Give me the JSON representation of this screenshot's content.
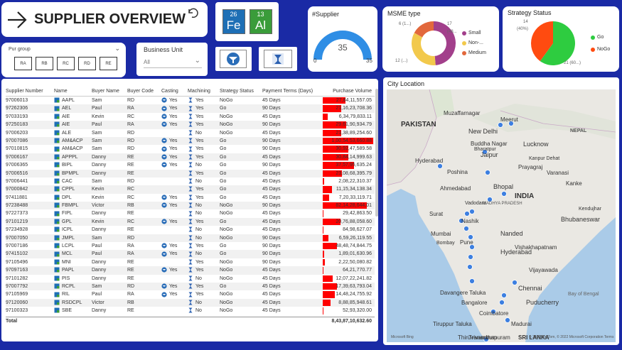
{
  "header": {
    "title": "SUPPLIER OVERVIEW",
    "back_icon": "arrow-right-icon",
    "undo_icon": "undo-icon"
  },
  "elements": [
    {
      "number": "26",
      "symbol": "Fe"
    },
    {
      "number": "13",
      "symbol": "Al"
    }
  ],
  "pur_group": {
    "label": "Pur group",
    "options": [
      "RA",
      "RB",
      "RC",
      "RD",
      "RE"
    ]
  },
  "business_unit": {
    "label": "Business Unit",
    "value": "All"
  },
  "supplier_card": {
    "title": "#Supplier",
    "value": "35",
    "min": "0",
    "max": "35",
    "fraction": 1.0
  },
  "msme": {
    "title": "MSME type",
    "legend": [
      {
        "label": "Small",
        "color": "#a23f8b"
      },
      {
        "label": "Non-...",
        "color": "#f2c94c"
      },
      {
        "label": "Medium",
        "color": "#e2683c"
      }
    ],
    "labels": [
      "17",
      "(48...",
      "6 (1...)",
      "12 (...)"
    ],
    "values": [
      17,
      12,
      6
    ]
  },
  "strategy_status": {
    "title": "Strategy Status",
    "legend": [
      {
        "label": "Go",
        "color": "#2ecc40"
      },
      {
        "label": "NoGo",
        "color": "#ff4b10"
      }
    ],
    "labels": [
      "14",
      "(40%)",
      "21 (60...)"
    ],
    "values": [
      21,
      14
    ]
  },
  "table": {
    "columns": [
      "Supplier Number",
      "Name",
      "Buyer Name",
      "Buyer Code",
      "Casting",
      "Machining",
      "Strategy Status",
      "Payment Terms (Days)",
      "Purchase Volume"
    ],
    "rows": [
      [
        "97006013",
        "AAPL",
        "Sam",
        "RD",
        "Yes",
        "Yes",
        "NoGo",
        "45 Days",
        "27,84,11,557.05",
        0.45
      ],
      [
        "97262306",
        "AEL",
        "Paul",
        "RA",
        "Yes",
        "Yes",
        "Go",
        "90 Days",
        "21,16,23,708.36",
        0.36
      ],
      [
        "97033193",
        "AIE",
        "Kevin",
        "RC",
        "Yes",
        "Yes",
        "NoGo",
        "45 Days",
        "6,34,79,833.11",
        0.1
      ],
      [
        "97250183",
        "AIE",
        "Paul",
        "RA",
        "Yes",
        "Yes",
        "NoGo",
        "90 Days",
        "29,61,90,934.79",
        0.47
      ],
      [
        "97006203",
        "ALE",
        "Sam",
        "RD",
        "",
        "No",
        "NoGo",
        "45 Days",
        "21,38,89,254.60",
        0.36
      ],
      [
        "97007086",
        "AM&ACP",
        "Sam",
        "RD",
        "Yes",
        "Yes",
        "Go",
        "90 Days",
        "1,00,54,53,660.88",
        1.0
      ],
      [
        "97010815",
        "AM&ACP",
        "Sam",
        "RD",
        "Yes",
        "Yes",
        "Go",
        "90 Days",
        "30,92,47,589.58",
        0.5
      ],
      [
        "97006167",
        "APPPL",
        "Danny",
        "RE",
        "Yes",
        "Yes",
        "Go",
        "45 Days",
        "30,84,14,999.63",
        0.5
      ],
      [
        "97006365",
        "BIPL",
        "Danny",
        "RE",
        "Yes",
        "No",
        "Go",
        "90 Days",
        "37,57,95,635.24",
        0.62
      ],
      [
        "97006516",
        "BPMPL",
        "Danny",
        "RE",
        "",
        "Yes",
        "Go",
        "45 Days",
        "23,08,68,395.79",
        0.38
      ],
      [
        "97006441",
        "CAC",
        "Sam",
        "RD",
        "",
        "No",
        "Go",
        "45 Days",
        "2,08,22,310.37",
        0.03
      ],
      [
        "97000842",
        "CPPL",
        "Kevin",
        "RC",
        "",
        "Yes",
        "Go",
        "45 Days",
        "11,15,34,138.34",
        0.18
      ],
      [
        "97411881",
        "DPL",
        "Kevin",
        "RC",
        "Yes",
        "Yes",
        "Go",
        "45 Days",
        "7,20,33,119.71",
        0.12
      ],
      [
        "97238488",
        "FBMPL",
        "Victor",
        "RB",
        "Yes",
        "No",
        "NoGo",
        "90 Days",
        "82,14,28,644.01",
        0.88
      ],
      [
        "97227373",
        "FIPL",
        "Danny",
        "RE",
        "",
        "No",
        "NoGo",
        "45 Days",
        "29,42,863.50",
        0.01
      ],
      [
        "97101219",
        "GPL",
        "Kevin",
        "RC",
        "Yes",
        "Yes",
        "Go",
        "45 Days",
        "20,76,88,058.60",
        0.35
      ],
      [
        "97234928",
        "ICPL",
        "Danny",
        "RE",
        "",
        "No",
        "NoGo",
        "45 Days",
        "84,98,627.07",
        0.02
      ],
      [
        "97007050",
        "JMPL",
        "Sam",
        "RD",
        "",
        "No",
        "NoGo",
        "90 Days",
        "6,59,26,119.55",
        0.11
      ],
      [
        "97007186",
        "LCPL",
        "Paul",
        "RA",
        "Yes",
        "Yes",
        "Go",
        "90 Days",
        "48,48,74,844.75",
        0.28
      ],
      [
        "97415102",
        "MCL",
        "Paul",
        "RA",
        "Yes",
        "No",
        "Go",
        "90 Days",
        "1,89,01,630.96",
        0.03
      ],
      [
        "97105496",
        "MNI",
        "Danny",
        "RE",
        "",
        "Yes",
        "NoGo",
        "90 Days",
        "2,22,50,080.82",
        0.04
      ],
      [
        "97097163",
        "PAPL",
        "Danny",
        "RE",
        "Yes",
        "Yes",
        "NoGo",
        "45 Days",
        "64,21,770.77",
        0.01
      ],
      [
        "97101282",
        "PIS",
        "Danny",
        "RE",
        "",
        "No",
        "NoGo",
        "45 Days",
        "12,07,22,241.82",
        0.2
      ],
      [
        "97007792",
        "RCPL",
        "Sam",
        "RD",
        "Yes",
        "Yes",
        "Go",
        "45 Days",
        "17,39,63,793.04",
        0.28
      ],
      [
        "97105969",
        "RIL",
        "Paul",
        "RA",
        "Yes",
        "Yes",
        "NoGo",
        "45 Days",
        "14,48,24,755.92",
        0.24
      ],
      [
        "97120060",
        "RSDCPL",
        "Victor",
        "RB",
        "",
        "No",
        "NoGo",
        "45 Days",
        "8,88,85,948.61",
        0.15
      ],
      [
        "97100323",
        "SBE",
        "Danny",
        "RE",
        "",
        "No",
        "NoGo",
        "45 Days",
        "52,93,320.00",
        0.01
      ]
    ],
    "total_label": "Total",
    "total_value": "8,43,87,10,632.60"
  },
  "map": {
    "title": "City Location",
    "labels": [
      "PAKISTAN",
      "Muzaffarnagar",
      "Meerut",
      "NEPAL",
      "New Delhi",
      "Buddha Nagar",
      "Lucknow",
      "Jaipur",
      "Bharatpur",
      "Kanpur Dehat",
      "Hyderabad",
      "Poshina",
      "Prayagraj",
      "Varanasi",
      "Ahmedabad",
      "Bhopal",
      "Kanke",
      "Surat",
      "INDIA",
      "Vadodara",
      "MADHYA PRADESH",
      "Kendujhar",
      "Nashik",
      "Bhubaneswar",
      "Mumbai",
      "Bombay",
      "Nanded",
      "Pune",
      "Vishakhapatnam",
      "Hyderabad",
      "Vijayawada",
      "Chennai",
      "Davangere Taluka",
      "Bangalore",
      "Puducherry",
      "Coimbatore",
      "Tiruppur Taluka",
      "Madurai",
      "Trivandrum",
      "Thiruvananthapuram",
      "SRI LANKA",
      "Bay of Bengal",
      "Microsoft Bing",
      "© 2022 TomTom, © 2022 Microsoft Corporation Terms"
    ]
  },
  "colors": {
    "background": "#1a2aa5",
    "bar": "#ff0000",
    "gauge": "#2f8ee5",
    "map_dot": "#3d7fe0"
  }
}
